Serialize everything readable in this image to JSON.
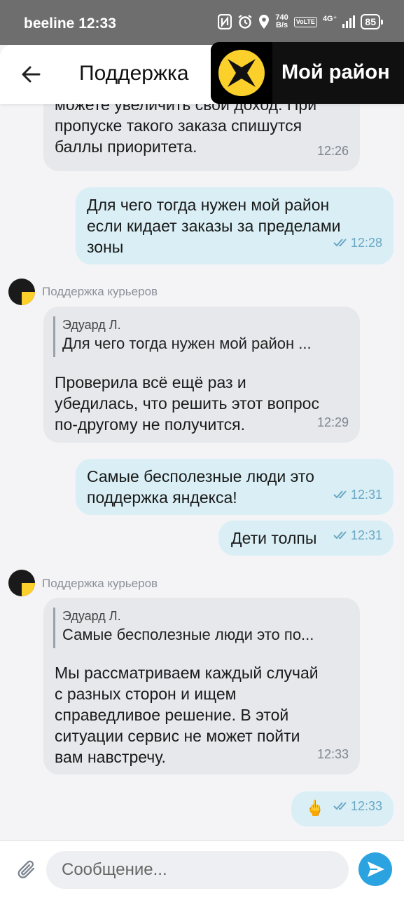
{
  "status_bar": {
    "carrier_time": "beeline 12:33",
    "speed_value": "740",
    "speed_unit": "B/s",
    "volte": "VoLTE",
    "network": "4G⁺",
    "battery": "85"
  },
  "header": {
    "title": "Поддержка",
    "back_icon": "arrow-left-icon",
    "search_icon": "search-icon"
  },
  "overlay": {
    "label": "Мой район",
    "logo_icon": "yandex-logo-icon"
  },
  "messages": [
    {
      "dir": "in",
      "text": "можете увеличить свой доход. При\nпропуске такого заказа спишутся\nбаллы приоритета.",
      "time": "12:26"
    },
    {
      "dir": "out",
      "text": "Для чего тогда нужен мой район\nесли кидает заказы за пределами\nзоны",
      "time": "12:28"
    },
    {
      "dir": "in",
      "sender": "Поддержка курьеров",
      "quote_author": "Эдуард Л.",
      "quote_text": "Для чего тогда нужен мой район ...",
      "text": "Проверила всё ещё раз и\nубедилась, что решить этот вопрос\nпо-другому не получится.",
      "time": "12:29"
    },
    {
      "dir": "out",
      "text": "Самые бесполезные люди это\nподдержка яндекса!",
      "time": "12:31"
    },
    {
      "dir": "out",
      "text": "Дети толпы",
      "time": "12:31"
    },
    {
      "dir": "in",
      "sender": "Поддержка курьеров",
      "quote_author": "Эдуард Л.",
      "quote_text": "Самые бесполезные люди это по...",
      "text": "Мы рассматриваем каждый случай\nс разных сторон и ищем\nсправедливое решение. В этой\nситуации сервис не может пойти\nвам навстречу.",
      "time": "12:33"
    },
    {
      "dir": "out",
      "text": "🖕",
      "time": "12:33"
    }
  ],
  "composer": {
    "placeholder": "Сообщение...",
    "attach_icon": "paperclip-icon",
    "send_icon": "send-icon"
  },
  "colors": {
    "incoming_bubble": "#e6e8ec",
    "outgoing_bubble": "#d9eff5",
    "read_check": "#6aa7c4",
    "send_button": "#2aa3e0",
    "brand_yellow": "#fcd02a"
  }
}
